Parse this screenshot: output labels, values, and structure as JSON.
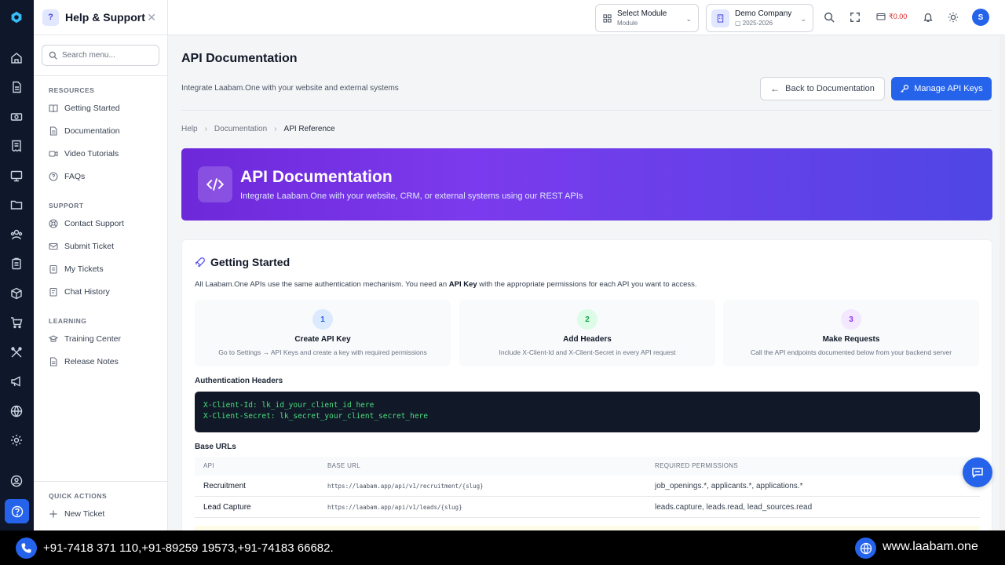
{
  "panel": {
    "title": "Help & Support",
    "search_placeholder": "Search menu...",
    "sections": [
      {
        "label": "RESOURCES",
        "items": [
          "Getting Started",
          "Documentation",
          "Video Tutorials",
          "FAQs"
        ]
      },
      {
        "label": "SUPPORT",
        "items": [
          "Contact Support",
          "Submit Ticket",
          "My Tickets",
          "Chat History"
        ]
      },
      {
        "label": "LEARNING",
        "items": [
          "Training Center",
          "Release Notes"
        ]
      }
    ],
    "quick_actions": {
      "label": "QUICK ACTIONS",
      "new_ticket": "New Ticket"
    }
  },
  "topbar": {
    "module": {
      "title": "Select Module",
      "sub": "Module"
    },
    "company": {
      "title": "Demo Company",
      "sub": "2025-2026"
    },
    "wallet": "₹0.00",
    "avatar": "S"
  },
  "page": {
    "title": "API Documentation",
    "subtitle": "Integrate Laabam.One with your website and external systems",
    "back_button": "Back to Documentation",
    "keys_button": "Manage API Keys",
    "breadcrumb": [
      "Help",
      "Documentation",
      "API Reference"
    ]
  },
  "hero": {
    "title": "API Documentation",
    "subtitle": "Integrate Laabam.One with your website, CRM, or external systems using our REST APIs"
  },
  "getting_started": {
    "title": "Getting Started",
    "desc_pre": "All Laabam.One APIs use the same authentication mechanism. You need an ",
    "desc_bold": "API Key",
    "desc_post": " with the appropriate permissions for each API you want to access.",
    "steps": [
      {
        "num": "1",
        "title": "Create API Key",
        "desc": "Go to Settings → API Keys and create a key with required permissions",
        "color": "#2563eb",
        "bg": "#dbeafe"
      },
      {
        "num": "2",
        "title": "Add Headers",
        "desc": "Include X-Client-Id and X-Client-Secret in every API request",
        "color": "#16a34a",
        "bg": "#dcfce7"
      },
      {
        "num": "3",
        "title": "Make Requests",
        "desc": "Call the API endpoints documented below from your backend server",
        "color": "#9333ea",
        "bg": "#f3e8ff"
      }
    ]
  },
  "auth": {
    "label": "Authentication Headers",
    "lines": [
      "X-Client-Id: lk_id_your_client_id_here",
      "X-Client-Secret: lk_secret_your_client_secret_here"
    ]
  },
  "base_urls": {
    "label": "Base URLs",
    "headers": [
      "API",
      "BASE URL",
      "REQUIRED PERMISSIONS"
    ],
    "rows": [
      {
        "api": "Recruitment",
        "url": "https://laabam.app/api/v1/recruitment/{slug}",
        "perms": "job_openings.*, applicants.*, applications.*"
      },
      {
        "api": "Lead Capture",
        "url": "https://laabam.app/api/v1/leads/{slug}",
        "perms": "leads.capture, leads.read, lead_sources.read"
      }
    ]
  },
  "footer": {
    "phones": "+91-7418 371 110,+91-89259 19573,+91-74183 66682.",
    "website": "www.laabam.one"
  }
}
